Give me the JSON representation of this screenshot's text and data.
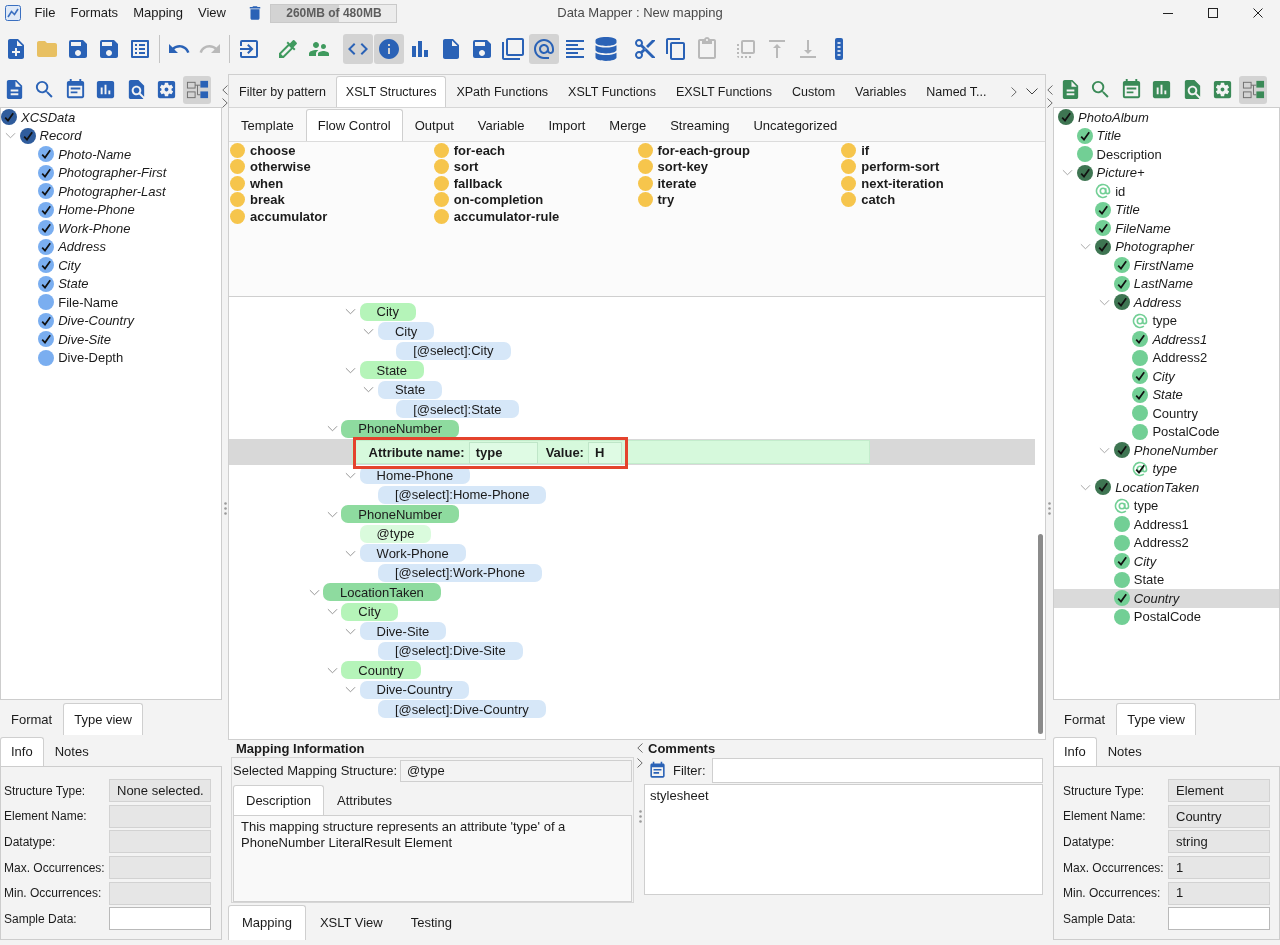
{
  "window": {
    "menu": [
      "File",
      "Formats",
      "Mapping",
      "View"
    ],
    "memory": {
      "label": "260MB of 480MB",
      "level": 0.54
    },
    "title": "Data Mapper : New mapping"
  },
  "toolbar": {
    "groups": [
      {
        "divided": true,
        "items": [
          {
            "kind": "new",
            "pressed": false,
            "disabled": false
          },
          {
            "kind": "open",
            "pressed": false,
            "disabled": false
          },
          {
            "kind": "save",
            "pressed": false,
            "disabled": false
          },
          {
            "kind": "save_as",
            "pressed": false,
            "disabled": false
          },
          {
            "kind": "table",
            "pressed": false,
            "disabled": false
          }
        ]
      },
      {
        "divided": true,
        "items": [
          {
            "kind": "undo",
            "pressed": false,
            "disabled": false
          },
          {
            "kind": "redo",
            "pressed": false,
            "disabled": true
          }
        ]
      },
      {
        "divided": false,
        "items": [
          {
            "kind": "exit",
            "pressed": false,
            "disabled": false
          }
        ]
      },
      {
        "divided": false,
        "items": [
          {
            "kind": "dropper",
            "pressed": false,
            "disabled": false
          },
          {
            "kind": "users",
            "pressed": false,
            "disabled": false
          }
        ]
      },
      {
        "divided": false,
        "items": [
          {
            "kind": "code",
            "pressed": true,
            "disabled": false
          },
          {
            "kind": "info",
            "pressed": true,
            "disabled": false
          },
          {
            "kind": "chart",
            "pressed": false,
            "disabled": false
          },
          {
            "kind": "code_file",
            "pressed": false,
            "disabled": false
          },
          {
            "kind": "save_sync",
            "pressed": false,
            "disabled": false
          },
          {
            "kind": "copy_doc",
            "pressed": false,
            "disabled": false
          },
          {
            "kind": "at",
            "pressed": true,
            "disabled": false
          },
          {
            "kind": "lines",
            "pressed": false,
            "disabled": false
          },
          {
            "kind": "database",
            "pressed": false,
            "disabled": false
          }
        ]
      },
      {
        "divided": false,
        "items": [
          {
            "kind": "cut",
            "pressed": false,
            "disabled": false
          },
          {
            "kind": "copy",
            "pressed": false,
            "disabled": false
          },
          {
            "kind": "paste",
            "pressed": false,
            "disabled": true
          }
        ]
      },
      {
        "divided": false,
        "items": [
          {
            "kind": "frame",
            "pressed": false,
            "disabled": true
          },
          {
            "kind": "move_up",
            "pressed": false,
            "disabled": true
          },
          {
            "kind": "move_down",
            "pressed": false,
            "disabled": true
          },
          {
            "kind": "column",
            "pressed": false,
            "disabled": false
          }
        ]
      }
    ]
  },
  "source": {
    "toolbar": [
      {
        "kind": "document",
        "pressed": false
      },
      {
        "kind": "search",
        "pressed": false
      },
      {
        "kind": "notepad",
        "pressed": false
      },
      {
        "kind": "chart",
        "pressed": false
      },
      {
        "kind": "find_document",
        "pressed": false
      },
      {
        "kind": "settings_document",
        "pressed": false
      },
      {
        "kind": "tree_layout",
        "pressed": true
      }
    ],
    "tree": [
      {
        "label": "XCSData",
        "kind": "complex",
        "checked": true,
        "selected": false,
        "children": [
          {
            "label": "Record",
            "kind": "complex",
            "checked": true,
            "selected": false,
            "expanded": true,
            "children": [
              {
                "label": "Photo-Name",
                "kind": "simple",
                "checked": true,
                "selected": false
              },
              {
                "label": "Photographer-First",
                "kind": "simple",
                "checked": true,
                "selected": false
              },
              {
                "label": "Photographer-Last",
                "kind": "simple",
                "checked": true,
                "selected": false
              },
              {
                "label": "Home-Phone",
                "kind": "simple",
                "checked": true,
                "selected": false
              },
              {
                "label": "Work-Phone",
                "kind": "simple",
                "checked": true,
                "selected": false
              },
              {
                "label": "Address",
                "kind": "simple",
                "checked": true,
                "selected": false
              },
              {
                "label": "City",
                "kind": "simple",
                "checked": true,
                "selected": false
              },
              {
                "label": "State",
                "kind": "simple",
                "checked": true,
                "selected": false
              },
              {
                "label": "File-Name",
                "kind": "simple",
                "checked": false,
                "selected": false
              },
              {
                "label": "Dive-Country",
                "kind": "simple",
                "checked": true,
                "selected": false
              },
              {
                "label": "Dive-Site",
                "kind": "simple",
                "checked": true,
                "selected": false
              },
              {
                "label": "Dive-Depth",
                "kind": "simple",
                "checked": false,
                "selected": false
              }
            ]
          }
        ]
      }
    ],
    "tabs": [
      {
        "label": "Format",
        "selected": false
      },
      {
        "label": "Type view",
        "selected": true
      }
    ],
    "info_tabs": [
      {
        "label": "Info",
        "selected": true
      },
      {
        "label": "Notes",
        "selected": false
      }
    ],
    "fields": [
      {
        "label": "Structure Type:",
        "value": "None selected.",
        "read_only": true
      },
      {
        "label": "Element Name:",
        "read_only": true
      },
      {
        "label": "Datatype:",
        "read_only": true
      },
      {
        "label": "Max. Occurrences:",
        "read_only": true
      },
      {
        "label": "Min. Occurrences:",
        "read_only": true
      },
      {
        "label": "Sample Data:",
        "read_only": false
      }
    ]
  },
  "palette": {
    "tabs": [
      {
        "label": "Filter by pattern",
        "selected": false
      },
      {
        "label": "XSLT Structures",
        "selected": true
      },
      {
        "label": "XPath Functions",
        "selected": false
      },
      {
        "label": "XSLT Functions",
        "selected": false
      },
      {
        "label": "EXSLT Functions",
        "selected": false
      },
      {
        "label": "Custom",
        "selected": false
      },
      {
        "label": "Variables",
        "selected": false
      },
      {
        "label": "Named T...",
        "selected": false
      }
    ],
    "subtabs": [
      {
        "label": "Template",
        "selected": false
      },
      {
        "label": "Flow Control",
        "selected": true
      },
      {
        "label": "Output",
        "selected": false
      },
      {
        "label": "Variable",
        "selected": false
      },
      {
        "label": "Import",
        "selected": false
      },
      {
        "label": "Merge",
        "selected": false
      },
      {
        "label": "Streaming",
        "selected": false
      },
      {
        "label": "Uncategorized",
        "selected": false
      }
    ],
    "columns": [
      [
        "choose",
        "otherwise",
        "when",
        "break",
        "accumulator"
      ],
      [
        "for-each",
        "sort",
        "fallback",
        "on-completion",
        "accumulator-rule"
      ],
      [
        "for-each-group",
        "sort-key",
        "iterate",
        "try"
      ],
      [
        "if",
        "perform-sort",
        "next-iteration",
        "catch"
      ]
    ]
  },
  "mapping_tree": {
    "nodes": [
      {
        "children": [
          {
            "children": [
              {
                "label": "City",
                "kind": "result",
                "expanded": true,
                "selected": false,
                "children": [
                  {
                    "label": "City",
                    "kind": "source",
                    "expanded": true,
                    "selected": false,
                    "children": [
                      {
                        "label": "[@select]:City",
                        "kind": "source",
                        "selected": false
                      }
                    ]
                  }
                ]
              },
              {
                "label": "State",
                "kind": "result",
                "expanded": true,
                "selected": false,
                "children": [
                  {
                    "label": "State",
                    "kind": "source",
                    "expanded": true,
                    "selected": false,
                    "children": [
                      {
                        "label": "[@select]:State",
                        "kind": "source",
                        "selected": false
                      }
                    ]
                  }
                ]
              }
            ]
          },
          {
            "label": "PhoneNumber",
            "kind": "result_parent",
            "expanded": true,
            "selected": false,
            "children": [
              {
                "kind": "attribute_editor",
                "selected": true,
                "highlighted": true,
                "name_label": "Attribute name:",
                "name_value": "type",
                "value_label": "Value:",
                "value": "H"
              },
              {
                "label": "Home-Phone",
                "kind": "source",
                "expanded": true,
                "selected": false,
                "children": [
                  {
                    "label": "[@select]:Home-Phone",
                    "kind": "source",
                    "selected": false
                  }
                ]
              }
            ]
          },
          {
            "label": "PhoneNumber",
            "kind": "result_parent",
            "expanded": true,
            "selected": false,
            "children": [
              {
                "label": "@type",
                "kind": "attribute",
                "selected": false
              },
              {
                "label": "Work-Phone",
                "kind": "source",
                "expanded": true,
                "selected": false,
                "children": [
                  {
                    "label": "[@select]:Work-Phone",
                    "kind": "source",
                    "selected": false
                  }
                ]
              }
            ]
          }
        ]
      },
      {
        "label": "LocationTaken",
        "kind": "result_parent",
        "expanded": true,
        "selected": false,
        "children": [
          {
            "label": "City",
            "kind": "result",
            "expanded": true,
            "selected": false,
            "children": [
              {
                "label": "Dive-Site",
                "kind": "source",
                "expanded": true,
                "selected": false,
                "children": [
                  {
                    "label": "[@select]:Dive-Site",
                    "kind": "source",
                    "selected": false
                  }
                ]
              }
            ]
          },
          {
            "label": "Country",
            "kind": "result",
            "expanded": true,
            "selected": false,
            "children": [
              {
                "label": "Dive-Country",
                "kind": "source",
                "expanded": true,
                "selected": false,
                "children": [
                  {
                    "label": "[@select]:Dive-Country",
                    "kind": "source",
                    "selected": false
                  }
                ]
              }
            ]
          }
        ]
      }
    ]
  },
  "mapping_information": {
    "title": "Mapping Information",
    "structure_label": "Selected Mapping Structure:",
    "structure_value": "@type",
    "tabs": [
      {
        "label": "Description",
        "selected": true
      },
      {
        "label": "Attributes",
        "selected": false
      }
    ],
    "description": "This mapping structure represents an attribute 'type' of a PhoneNumber LiteralResult Element"
  },
  "comments": {
    "title": "Comments",
    "filter_label": "Filter:",
    "items": [
      "stylesheet"
    ]
  },
  "view_tabs": [
    {
      "label": "Mapping",
      "selected": true
    },
    {
      "label": "XSLT View",
      "selected": false
    },
    {
      "label": "Testing",
      "selected": false
    }
  ],
  "target": {
    "toolbar": [
      {
        "kind": "document",
        "pressed": false
      },
      {
        "kind": "search",
        "pressed": false
      },
      {
        "kind": "notepad",
        "pressed": false
      },
      {
        "kind": "chart",
        "pressed": false
      },
      {
        "kind": "find_document",
        "pressed": false
      },
      {
        "kind": "settings_document",
        "pressed": false
      },
      {
        "kind": "tree_layout",
        "pressed": true
      }
    ],
    "tree": [
      {
        "label": "PhotoAlbum",
        "kind": "complex",
        "checked": true,
        "selected": false,
        "children": [
          {
            "label": "Title",
            "kind": "simple",
            "checked": true,
            "selected": false
          },
          {
            "label": "Description",
            "kind": "simple",
            "checked": false,
            "selected": false
          },
          {
            "label": "Picture+",
            "kind": "complex",
            "checked": true,
            "selected": false,
            "expanded": true,
            "children": [
              {
                "label": "id",
                "kind": "attribute",
                "checked": false,
                "selected": false
              },
              {
                "label": "Title",
                "kind": "simple",
                "checked": true,
                "selected": false
              },
              {
                "label": "FileName",
                "kind": "simple",
                "checked": true,
                "selected": false
              },
              {
                "label": "Photographer",
                "kind": "complex",
                "checked": true,
                "selected": false,
                "expanded": true,
                "children": [
                  {
                    "label": "FirstName",
                    "kind": "simple",
                    "checked": true,
                    "selected": false
                  },
                  {
                    "label": "LastName",
                    "kind": "simple",
                    "checked": true,
                    "selected": false
                  },
                  {
                    "label": "Address",
                    "kind": "complex",
                    "checked": true,
                    "selected": false,
                    "expanded": true,
                    "children": [
                      {
                        "label": "type",
                        "kind": "attribute",
                        "checked": false,
                        "selected": false
                      },
                      {
                        "label": "Address1",
                        "kind": "simple",
                        "checked": true,
                        "selected": false
                      },
                      {
                        "label": "Address2",
                        "kind": "simple",
                        "checked": false,
                        "selected": false
                      },
                      {
                        "label": "City",
                        "kind": "simple",
                        "checked": true,
                        "selected": false
                      },
                      {
                        "label": "State",
                        "kind": "simple",
                        "checked": true,
                        "selected": false
                      },
                      {
                        "label": "Country",
                        "kind": "simple",
                        "checked": false,
                        "selected": false
                      },
                      {
                        "label": "PostalCode",
                        "kind": "simple",
                        "checked": false,
                        "selected": false
                      }
                    ]
                  },
                  {
                    "label": "PhoneNumber",
                    "kind": "complex",
                    "checked": true,
                    "selected": false,
                    "expanded": true,
                    "children": [
                      {
                        "label": "type",
                        "kind": "attribute",
                        "checked": true,
                        "selected": false
                      }
                    ]
                  }
                ]
              },
              {
                "label": "LocationTaken",
                "kind": "complex",
                "checked": true,
                "selected": false,
                "expanded": true,
                "children": [
                  {
                    "label": "type",
                    "kind": "attribute",
                    "checked": false,
                    "selected": false
                  },
                  {
                    "label": "Address1",
                    "kind": "simple",
                    "checked": false,
                    "selected": false
                  },
                  {
                    "label": "Address2",
                    "kind": "simple",
                    "checked": false,
                    "selected": false
                  },
                  {
                    "label": "City",
                    "kind": "simple",
                    "checked": true,
                    "selected": false
                  },
                  {
                    "label": "State",
                    "kind": "simple",
                    "checked": false,
                    "selected": false
                  },
                  {
                    "label": "Country",
                    "kind": "simple",
                    "checked": true,
                    "selected": true
                  },
                  {
                    "label": "PostalCode",
                    "kind": "simple",
                    "checked": false,
                    "selected": false
                  }
                ]
              }
            ]
          }
        ]
      }
    ],
    "tabs": [
      {
        "label": "Format",
        "selected": false
      },
      {
        "label": "Type view",
        "selected": true
      }
    ],
    "info_tabs": [
      {
        "label": "Info",
        "selected": true
      },
      {
        "label": "Notes",
        "selected": false
      }
    ],
    "fields": [
      {
        "label": "Structure Type:",
        "value": "Element",
        "read_only": true
      },
      {
        "label": "Element Name:",
        "value": "Country",
        "read_only": true
      },
      {
        "label": "Datatype:",
        "value": "string",
        "read_only": true
      },
      {
        "label": "Max. Occurrences:",
        "value": "1",
        "read_only": true
      },
      {
        "label": "Min. Occurrences:",
        "value": "1",
        "read_only": true
      },
      {
        "label": "Sample Data:",
        "read_only": false
      }
    ]
  }
}
